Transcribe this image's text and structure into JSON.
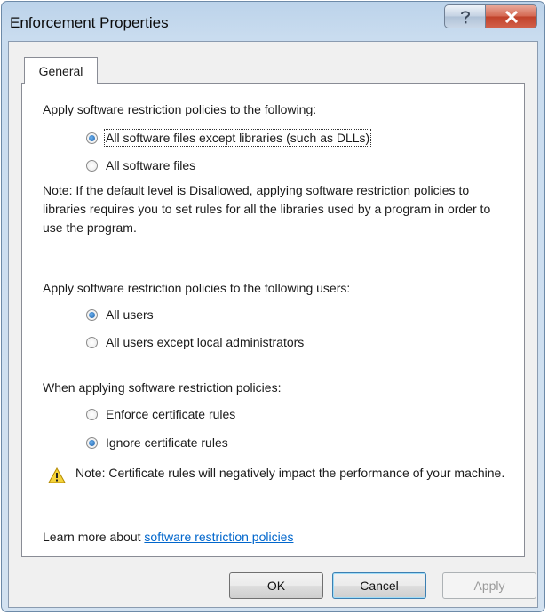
{
  "window": {
    "title": "Enforcement Properties"
  },
  "caption_buttons": {
    "help_glyph": "?",
    "close_glyph": "X"
  },
  "tabs": [
    {
      "label": "General"
    }
  ],
  "section_files": {
    "heading": "Apply software restriction policies to the following:",
    "options": [
      {
        "label": "All software files except libraries (such as DLLs)",
        "selected": true
      },
      {
        "label": "All software files",
        "selected": false
      }
    ],
    "note": "Note:  If the default level is Disallowed, applying software restriction policies to libraries requires you to set rules for all the libraries used by a program in order to use the program."
  },
  "section_users": {
    "heading": "Apply software restriction policies to the following users:",
    "options": [
      {
        "label": "All users",
        "selected": true
      },
      {
        "label": "All users except local administrators",
        "selected": false
      }
    ]
  },
  "section_certificates": {
    "heading": "When applying software restriction policies:",
    "options": [
      {
        "label": "Enforce certificate rules",
        "selected": false
      },
      {
        "label": "Ignore certificate rules",
        "selected": true
      }
    ],
    "warning": "Note:  Certificate rules will negatively impact the performance of your machine."
  },
  "learn_more": {
    "prefix": "Learn more about ",
    "link_text": "software restriction policies"
  },
  "buttons": {
    "ok": "OK",
    "cancel": "Cancel",
    "apply": "Apply"
  },
  "icons": {
    "warning": "warning-icon"
  },
  "colors": {
    "accent": "#0066cc",
    "selected_radio": "#1b5ea8",
    "close": "#c0412a"
  }
}
